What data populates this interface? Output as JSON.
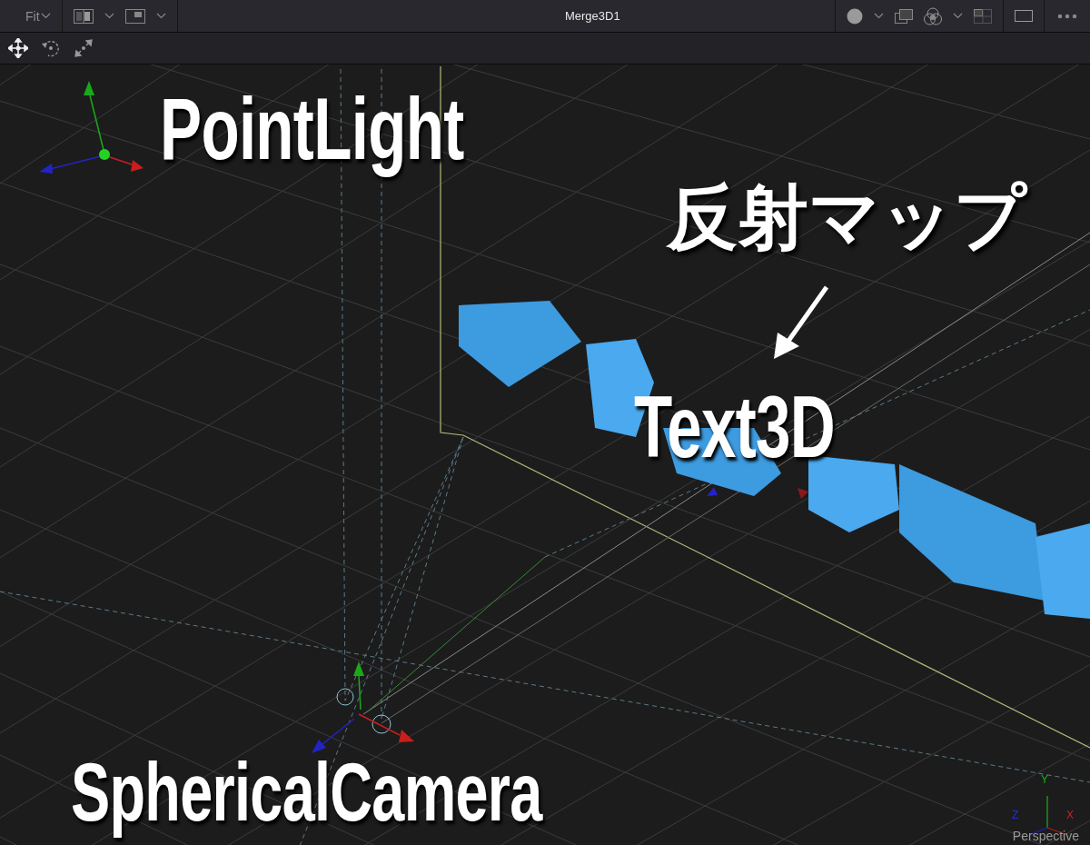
{
  "top_bar": {
    "zoom_button": "Fit",
    "title": "Merge3D1"
  },
  "viewport": {
    "annotations": [
      {
        "text": "PointLight"
      },
      {
        "text": "反射マップ"
      },
      {
        "text": "Text3D"
      },
      {
        "text": "SphericalCamera"
      }
    ],
    "axis_labels": [
      "Y",
      "Z",
      "X"
    ],
    "view_label": "Perspective"
  }
}
